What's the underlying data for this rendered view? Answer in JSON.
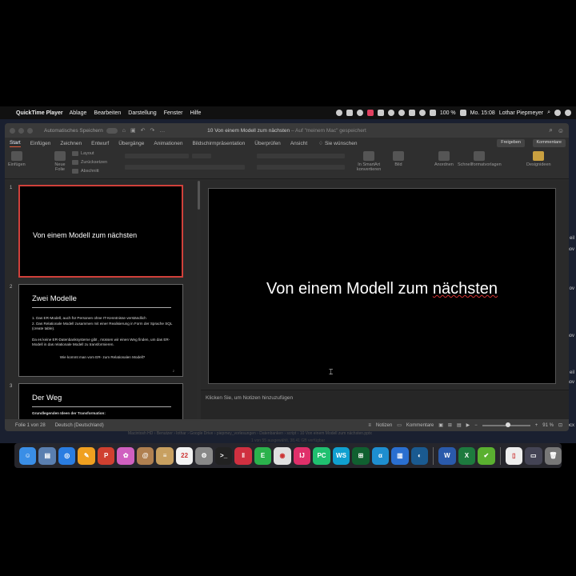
{
  "menubar": {
    "app_name": "QuickTime Player",
    "items": [
      "Ablage",
      "Bearbeiten",
      "Darstellung",
      "Fenster",
      "Hilfe"
    ],
    "battery": "100 %",
    "clock": "Mo. 15:08",
    "user": "Lothar Piepmeyer"
  },
  "window": {
    "autosave_label": "Automatisches Speichern",
    "doc_title": "10 Von einem Modell zum nächsten",
    "doc_subtitle": " – Auf \"meinem Mac\" gespeichert",
    "tabs": [
      "Start",
      "Einfügen",
      "Zeichnen",
      "Entwurf",
      "Übergänge",
      "Animationen",
      "Bildschirmpräsentation",
      "Überprüfen",
      "Ansicht"
    ],
    "search_label": "Sie wünschen",
    "share_label": "Freigeben",
    "comments_label": "Kommentare"
  },
  "ribbon": {
    "paste_label": "Einfügen",
    "new_slide_label": "Neue\nFolie",
    "layout_label": "Layout",
    "reset_label": "Zurücksetzen",
    "section_label": "Abschnitt",
    "smartart_label": "In SmartArt\nkonvertieren",
    "picture_label": "Bild",
    "arrange_label": "Anordnen",
    "quick_styles_label": "Schnellformatvorlagen",
    "designer_label": "Designideen"
  },
  "thumbnails": [
    {
      "num": "1",
      "title": "Von einem Modell zum nächsten"
    },
    {
      "num": "2",
      "heading": "Zwei Modelle",
      "items": [
        "1.  Das ER-Modell, auch für Personen ohne IT-Kenntnisse verständlich",
        "2.  Das Relationale Modell zusammen mit einer Realisierung in Form der Sprache SQL (create table)."
      ],
      "para": "Da es keine ER-Datenbanksysteme gibt , müssen wir einen Weg finden, um das ER-Modell in das relationale Modell zu transformieren.",
      "question": "Wie kommt man vom ER- zum Relationalen Modell?",
      "page": "2"
    },
    {
      "num": "3",
      "heading": "Der Weg",
      "subtitle": "Grundlegenden Ideen der Transformation:"
    }
  ],
  "slide": {
    "title_plain": "Von einem Modell zum ",
    "title_marked": "nächsten"
  },
  "notes_placeholder": "Klicken Sie, um Notizen hinzuzufügen",
  "statusbar": {
    "slide_info": "Folie 1 von 28",
    "language": "Deutsch (Deutschland)",
    "notes": "Notizen",
    "comments": "Kommentare",
    "zoom": "91 %",
    "zoom_fraction": 0.55
  },
  "finder": {
    "path": "Macintosh HD  ›  Benutzer  ›  lothar  ›  Google Drive  ›  piepmey_vorlesungen  ›  Datenbanken  ›  script  ›  10 Von einem Modell zum nächsten.pptx",
    "status": "1 von 55 ausgewählt, 38,41 GB verfügbar"
  },
  "desktop_labels": [
    "eil",
    "nov",
    "ov",
    "nov",
    "eil",
    "nov",
    "ocx"
  ],
  "dock": {
    "apps": [
      {
        "name": "finder",
        "color": "#3a8ee6",
        "glyph": "☺"
      },
      {
        "name": "preview",
        "color": "#5a7fb0",
        "glyph": "▤"
      },
      {
        "name": "safari",
        "color": "#2a7de1",
        "glyph": "◎"
      },
      {
        "name": "pages",
        "color": "#f0a020",
        "glyph": "✎"
      },
      {
        "name": "powerpoint-red",
        "color": "#d04030",
        "glyph": "P"
      },
      {
        "name": "photos",
        "color": "#d060c0",
        "glyph": "✿"
      },
      {
        "name": "contacts",
        "color": "#b08050",
        "glyph": "@"
      },
      {
        "name": "notes",
        "color": "#c8a060",
        "glyph": "≡"
      },
      {
        "name": "calendar",
        "color": "#f4f4f4",
        "glyph": "22"
      },
      {
        "name": "preferences",
        "color": "#888",
        "glyph": "⚙"
      },
      {
        "name": "terminal",
        "color": "#222",
        "glyph": ">_"
      },
      {
        "name": "parallels",
        "color": "#d03040",
        "glyph": "‖"
      },
      {
        "name": "evernote",
        "color": "#2bb24c",
        "glyph": "E"
      },
      {
        "name": "chrome",
        "color": "#e0e0e0",
        "glyph": "◉"
      },
      {
        "name": "intellij",
        "color": "#e0306a",
        "glyph": "IJ"
      },
      {
        "name": "pycharm",
        "color": "#20c070",
        "glyph": "PC"
      },
      {
        "name": "webstorm",
        "color": "#10a0d0",
        "glyph": "WS"
      },
      {
        "name": "network",
        "color": "#106030",
        "glyph": "⊞"
      },
      {
        "name": "affinity",
        "color": "#1e8ed0",
        "glyph": "α"
      },
      {
        "name": "trello",
        "color": "#2a6fd0",
        "glyph": "▥"
      },
      {
        "name": "edge",
        "color": "#1a5a90",
        "glyph": "◐"
      },
      {
        "name": "word",
        "color": "#2a5aab",
        "glyph": "W"
      },
      {
        "name": "excel",
        "color": "#1d7a3e",
        "glyph": "X"
      },
      {
        "name": "checkmark",
        "color": "#5ab030",
        "glyph": "✔"
      },
      {
        "name": "document",
        "color": "#eee",
        "glyph": "▯"
      },
      {
        "name": "downloads",
        "color": "#445",
        "glyph": "▭"
      },
      {
        "name": "trash",
        "color": "#777",
        "glyph": "🗑"
      }
    ]
  }
}
